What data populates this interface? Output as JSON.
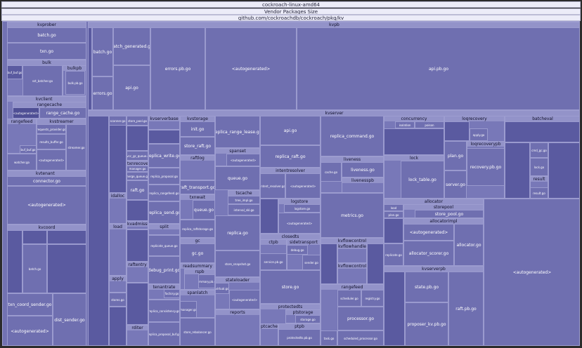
{
  "window_title": "cockroach-linux-amd64",
  "chart_title": "Vendor Packages Size",
  "root_path": "github.com/cockroachdb/cockroach/pkg/kv",
  "colors": {
    "header_bg": "#ececf8",
    "pkg_header": "#9393c9",
    "file_fill": "#6f6fb0",
    "border": "#9d9dd0"
  },
  "labels": {
    "kvprober": "kvprober",
    "batch": "batch.go",
    "txn": "txn.go",
    "bulk": "bulk",
    "bulkpb": "bulkpb",
    "sst_batcher": "sst_batcher.go",
    "buf": "buf_buf.go",
    "bulk_pb": "bulk.pb.go",
    "kvclient": "kvclient",
    "rangecache": "rangecache",
    "range_cache": "range_cache.go",
    "rangefeed_c": "rangefeed",
    "kvstreamer": "kvstreamer",
    "requests_provider": "requests_provider.go",
    "results_buffer": "results_buffer.go",
    "streamer": "streamer.go",
    "autogenerated": "<autogenerated>",
    "rangefeedcache": "rangefeedcache",
    "watcher": "watcher.go",
    "kvtenant": "kvtenant",
    "connector": "connector.go",
    "kvcoord": "kvcoord",
    "batch_kc": "batch.go",
    "txn_coord_sender": "txn_coord_sender.go",
    "dist_sender": "dist_sender.go",
    "kvpb": "kvpb",
    "batch_generated": "batch_generated.go",
    "errors": "errors.go",
    "api": "api.go",
    "errors_pb": "errors.pb.go",
    "api_pb": "api.pb.go",
    "kvserver": "kvserver",
    "kvserverbase": "kvserverbase",
    "kvstorage": "kvstorage",
    "init": "init.go",
    "store_raft": "store_raft.go",
    "replica_range_lease": "replica_range_lease.go",
    "api_ks": "api.go",
    "replica_raft": "replica_raft.go",
    "replica_command": "replica_command.go",
    "spanset": "spanset",
    "queue": "queue.go",
    "intentresolver": "intentresolver",
    "intent_resolver": "intent_resolver.go",
    "liveness": "liveness",
    "liveness_go": "liveness.go",
    "livenesspb": "livenesspb",
    "cache": "cache.go",
    "concurrency": "concurrency",
    "isolation": "isolation",
    "poison": "poison",
    "lock": "lock",
    "lock_table": "lock_table.go",
    "loqrecovery": "loqrecovery",
    "apply_go": "apply.go",
    "plan": "plan.go",
    "loqrecoverypb": "loqrecoverypb",
    "recovery_pb": "recovery.pb.go",
    "server": "server.go",
    "batcheval": "batcheval",
    "cmd_gc": "cmd_gc.go",
    "lock_go": "lock.go",
    "result": "result",
    "result_go": "result.go",
    "scanner": "scanner.go",
    "store_pool_go": "store_pool.go",
    "mvcc_gc_queue": "mvcc_gc_queue.go",
    "txnrecovery": "txnrecovery",
    "manager": "manager.go",
    "merge_queue": "merge_queue.go",
    "raft": "raft.go",
    "replica_write": "replica_write.go",
    "replica_proposal": "replica_proposal.go",
    "raftlog": "raftlog",
    "raft_transport": "raft_transport.go",
    "tscache": "tscache",
    "tree_impl": "tree_impl.go",
    "interval_skl": "interval_skl.go",
    "replica_rangefeed": "replica_rangefeed.go",
    "replica_send": "replica_send.go",
    "txnwait": "txnwait",
    "queue_tw": "queue.go",
    "replica_raftstorage": "replica_raftstorage.go",
    "logstore": "logstore",
    "logstore_go": "logstore.go",
    "metrics": "metrics.go",
    "replica": "replica.go",
    "idalloc": "idalloc",
    "load": "load",
    "kvadmission": "kvadmission",
    "split": "split",
    "replicate_queue": "replicate_queue.go",
    "gc": "gc",
    "gc_go": "gc.go",
    "store_snapshot": "store_snapshot.go",
    "closedts": "closedts",
    "ctpb": "ctpb",
    "sidetransport": "sidetransport",
    "service_pb": "service.pb.go",
    "debug": "debug.go",
    "sender": "sender.go",
    "kvflowcontrol": "kvflowcontrol",
    "kvflowhandle": "kvflowhandle",
    "kvflowcontroller": "kvflowcontroller",
    "allocator": "allocator",
    "storepool": "storepool",
    "store_pool": "store_pool.go",
    "allocatorimpl": "allocatorimpl",
    "allocator_scorer": "allocator_scorer.go",
    "allocator_go": "allocator.go",
    "kvserverpb": "kvserverpb",
    "state_pb": "state.pb.go",
    "proposer_kv": "proposer_kv.pb.go",
    "raft_pb": "raft.pb.go",
    "replicate": "replicate.go",
    "apply": "apply",
    "stores": "stores.go",
    "raftentry": "raftentry",
    "debug_print": "debug_print.go",
    "tenantrate": "tenantrate",
    "factory": "factory.go",
    "readsummary": "readsummary",
    "rspb": "rspb",
    "summary_pb": "summary.pb.go",
    "spanlatch": "spanlatch",
    "manager_sl": "manager.go",
    "rditer": "rditer",
    "store_rebalancer": "store_rebalancer.go",
    "reports": "reports",
    "stateloader": "stateloader",
    "virtual": "virtual.go",
    "store_go": "store.go",
    "rangefeed_ks": "rangefeed",
    "scheduler": "scheduler.go",
    "registry": "registry.go",
    "processor": "processor.go",
    "scheduled_processor": "scheduled_processor.go",
    "protectedts": "protectedts",
    "ptstorage": "ptstorage",
    "storage_go": "storage.go",
    "ptpb": "ptpb",
    "protectedts_pb": "protectedts.pb.go",
    "ptcache": "ptcache",
    "cache_go": "cache.go",
    "task": "task.go",
    "replica_consistency": "replica_consistency.go",
    "replica_proposal_buf": "replica_proposal_buf.go",
    "replica_command_s": "replica_command.go",
    "replica_read": "replica_read.go"
  }
}
